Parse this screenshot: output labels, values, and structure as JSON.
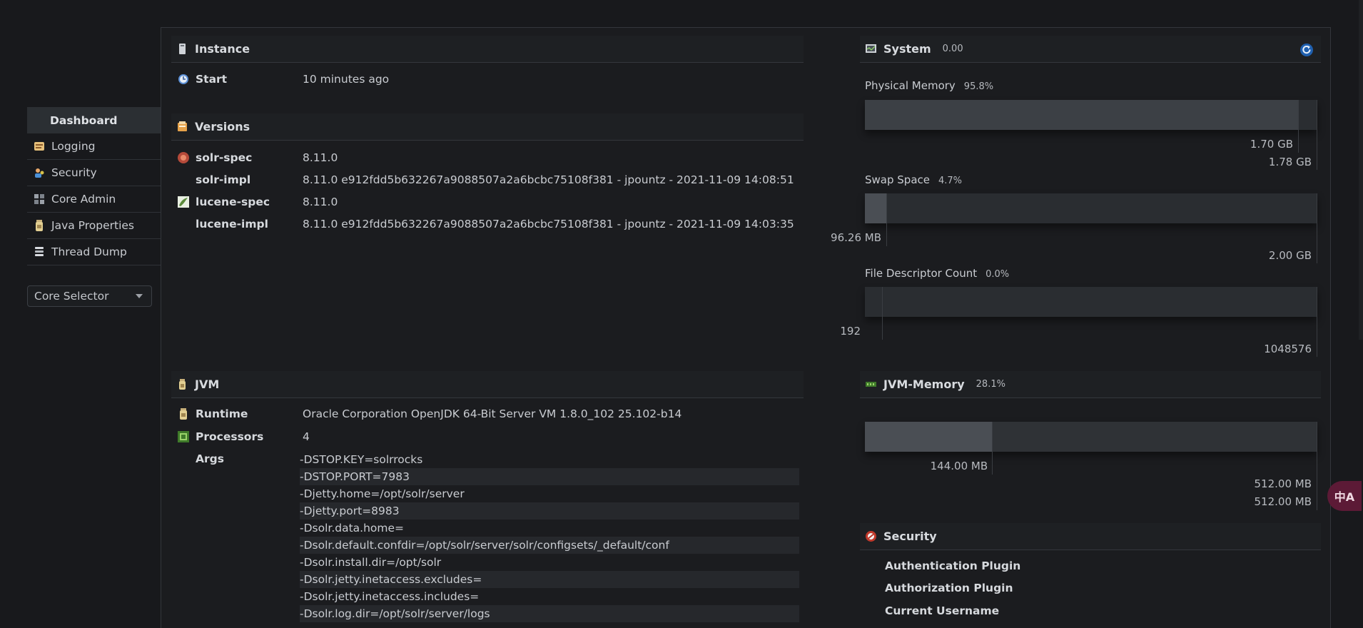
{
  "sidebar": {
    "items": [
      {
        "label": "Dashboard",
        "icon": "dashboard-icon",
        "active": true
      },
      {
        "label": "Logging",
        "icon": "logging-icon"
      },
      {
        "label": "Security",
        "icon": "security-icon"
      },
      {
        "label": "Core Admin",
        "icon": "core-admin-icon"
      },
      {
        "label": "Java Properties",
        "icon": "java-properties-icon"
      },
      {
        "label": "Thread Dump",
        "icon": "thread-dump-icon"
      }
    ],
    "core_selector": "Core Selector"
  },
  "instance": {
    "title": "Instance",
    "start_label": "Start",
    "start_value": "10 minutes ago"
  },
  "versions": {
    "title": "Versions",
    "rows": [
      {
        "label": "solr-spec",
        "value": "8.11.0"
      },
      {
        "label": "solr-impl",
        "value": "8.11.0 e912fdd5b632267a9088507a2a6bcbc75108f381 - jpountz - 2021-11-09 14:08:51"
      },
      {
        "label": "lucene-spec",
        "value": "8.11.0"
      },
      {
        "label": "lucene-impl",
        "value": "8.11.0 e912fdd5b632267a9088507a2a6bcbc75108f381 - jpountz - 2021-11-09 14:03:35"
      }
    ]
  },
  "jvm": {
    "title": "JVM",
    "runtime_label": "Runtime",
    "runtime_value": "Oracle Corporation OpenJDK 64-Bit Server VM 1.8.0_102 25.102-b14",
    "processors_label": "Processors",
    "processors_value": "4",
    "args_label": "Args",
    "args": [
      "-DSTOP.KEY=solrrocks",
      "-DSTOP.PORT=7983",
      "-Djetty.home=/opt/solr/server",
      "-Djetty.port=8983",
      "-Dsolr.data.home=",
      "-Dsolr.default.confdir=/opt/solr/server/solr/configsets/_default/conf",
      "-Dsolr.install.dir=/opt/solr",
      "-Dsolr.jetty.inetaccess.excludes=",
      "-Dsolr.jetty.inetaccess.includes=",
      "-Dsolr.log.dir=/opt/solr/server/logs"
    ]
  },
  "system": {
    "title": "System",
    "load": "0.00",
    "physical_memory": {
      "label": "Physical Memory",
      "percent": "95.8%",
      "fraction": 0.958,
      "used": "1.70 GB",
      "total": "1.78 GB"
    },
    "swap_space": {
      "label": "Swap Space",
      "percent": "4.7%",
      "fraction": 0.047,
      "used": "96.26 MB",
      "total": "2.00 GB"
    },
    "file_descriptor": {
      "label": "File Descriptor Count",
      "percent": "0.0%",
      "fraction": 0.0,
      "used": "192",
      "total": "1048576"
    }
  },
  "jvm_memory": {
    "title": "JVM-Memory",
    "percent": "28.1%",
    "used_fraction": 0.281,
    "used": "144.00 MB",
    "committed": "512.00 MB",
    "max": "512.00 MB"
  },
  "security": {
    "title": "Security",
    "items": [
      "Authentication Plugin",
      "Authorization Plugin",
      "Current Username"
    ]
  },
  "translate_button": "中A",
  "colors": {
    "background": "#18191c",
    "panel": "#1b1c1f",
    "bar": "#2a2d31",
    "bar_fill": "#3c4045",
    "translate": "#5c1a36",
    "refresh": "#2f7fd6"
  }
}
